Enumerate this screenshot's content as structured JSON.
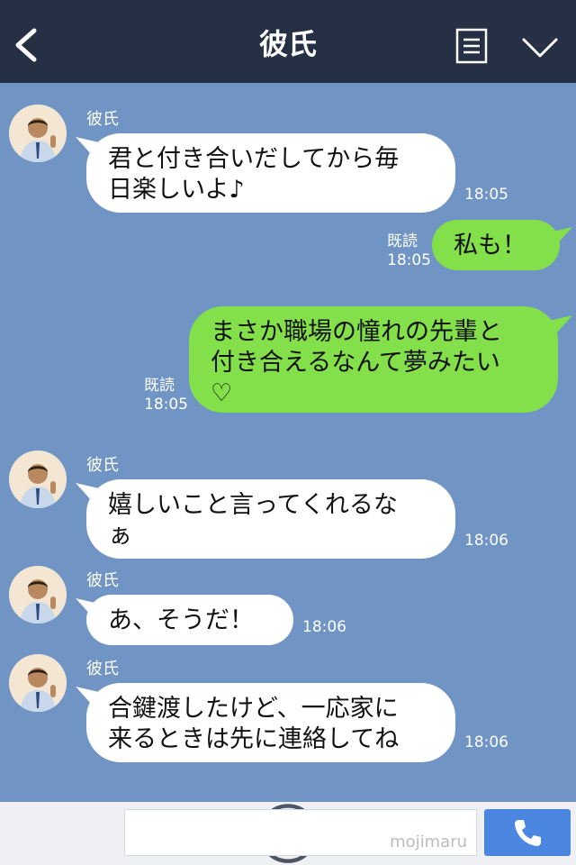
{
  "header": {
    "title": "彼氏"
  },
  "messages": [
    {
      "sender": "彼氏",
      "text": "君と付き合いだしてから毎\n日楽しいよ♪",
      "time": "18:05"
    },
    {
      "text": "私も！",
      "read": "既読",
      "time": "18:05"
    },
    {
      "text": "まさか職場の憧れの先輩と\n付き合えるなんて夢みたい\n♡",
      "read": "既読",
      "time": "18:05"
    },
    {
      "sender": "彼氏",
      "text": "嬉しいこと言ってくれるな\nぁ",
      "time": "18:06"
    },
    {
      "sender": "彼氏",
      "text": "あ、そうだ！",
      "time": "18:06"
    },
    {
      "sender": "彼氏",
      "text": "合鍵渡したけど、一応家に\n来るときは先に連絡してね",
      "time": "18:06"
    }
  ],
  "input": {
    "watermark": "mojimaru"
  },
  "colors": {
    "header": "#263044",
    "background": "#7094c4",
    "incoming": "#ffffff",
    "outgoing": "#84e04a",
    "call_button": "#4b86e1"
  },
  "icons": [
    "back-icon",
    "menu-icon",
    "chevron-down-icon",
    "plus-icon",
    "smiley-icon",
    "phone-icon"
  ]
}
